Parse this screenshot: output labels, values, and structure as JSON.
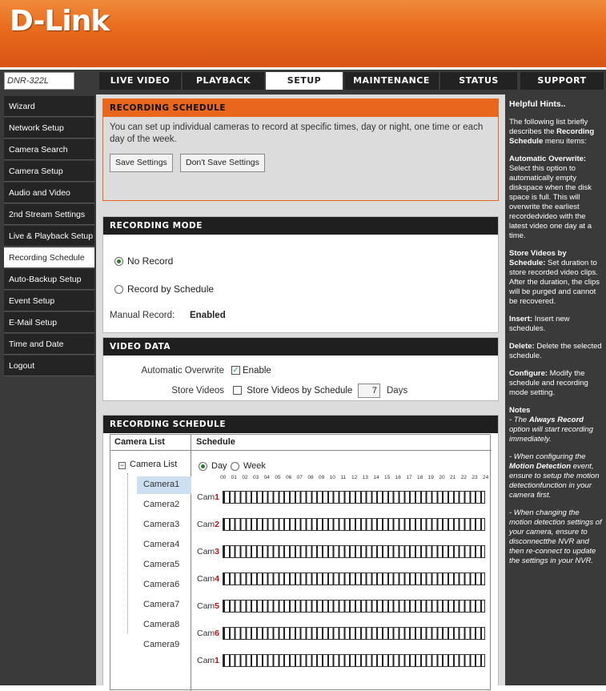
{
  "brand": {
    "logo": "D-Link",
    "model": "DNR-322L"
  },
  "tabs": [
    {
      "label": "LIVE VIDEO"
    },
    {
      "label": "PLAYBACK"
    },
    {
      "label": "SETUP"
    },
    {
      "label": "MAINTENANCE"
    },
    {
      "label": "STATUS"
    },
    {
      "label": "SUPPORT"
    }
  ],
  "sidebar": {
    "items": [
      {
        "label": "Wizard"
      },
      {
        "label": "Network Setup"
      },
      {
        "label": "Camera Search"
      },
      {
        "label": "Camera Setup"
      },
      {
        "label": "Audio and Video"
      },
      {
        "label": "2nd Stream Settings"
      },
      {
        "label": "Live & Playback Setup"
      },
      {
        "label": "Recording Schedule"
      },
      {
        "label": "Auto-Backup Setup"
      },
      {
        "label": "Event Setup"
      },
      {
        "label": "E-Mail Setup"
      },
      {
        "label": "Time and Date"
      },
      {
        "label": "Logout"
      }
    ]
  },
  "intro": {
    "title": "RECORDING SCHEDULE",
    "text": "You can set up individual cameras to record at specific times, day or night, one time or each day of the week.",
    "save_label": "Save Settings",
    "dont_save_label": "Don't Save Settings"
  },
  "recording_mode": {
    "title": "RECORDING MODE",
    "no_record_label": "No Record",
    "by_schedule_label": "Record by Schedule",
    "manual_label": "Manual Record:",
    "manual_value": "Enabled"
  },
  "video_data": {
    "title": "VIDEO DATA",
    "overwrite_label": "Automatic Overwrite",
    "overwrite_option": "Enable",
    "store_label": "Store Videos",
    "store_option": "Store Videos by Schedule",
    "days_value": "7",
    "days_unit": "Days"
  },
  "schedule": {
    "title": "RECORDING SCHEDULE",
    "col_camera_list": "Camera List",
    "col_schedule": "Schedule",
    "tree_root": "Camera List",
    "cameras": [
      "Camera1",
      "Camera2",
      "Camera3",
      "Camera4",
      "Camera5",
      "Camera6",
      "Camera7",
      "Camera8",
      "Camera9"
    ],
    "day_label": "Day",
    "week_label": "Week",
    "hours": [
      "00",
      "01",
      "02",
      "03",
      "04",
      "05",
      "06",
      "07",
      "08",
      "09",
      "10",
      "11",
      "12",
      "13",
      "14",
      "15",
      "16",
      "17",
      "18",
      "19",
      "20",
      "21",
      "22",
      "23",
      "24"
    ],
    "cam_prefix": "Cam",
    "cam_numbers": [
      "1",
      "2",
      "3",
      "4",
      "5",
      "6",
      "1"
    ]
  },
  "hints": {
    "title": "Helpful Hints..",
    "intro_pre": "The following list briefly describes the",
    "intro_bold": "Recording Schedule",
    "intro_post": "menu items:",
    "overwrite_title": "Automatic Overwrite:",
    "overwrite_text": "Select this option to automatically empty diskspace when the disk space is full. This will overwrite the earliest recordedvideo with the latest video one day at a time.",
    "store_title": "Store Videos by Schedule:",
    "store_text": "Set duration to store recorded video clips. After the duration, the clips will be purged and cannot be recovered.",
    "insert_title": "Insert:",
    "insert_text": "Insert new schedules.",
    "delete_title": "Delete:",
    "delete_text": "Delete the selected schedule.",
    "configure_title": "Configure:",
    "configure_text": "Modify the schedule and recording mode setting.",
    "notes_title": "Notes",
    "note1_pre": "- The",
    "note1_bold": "Always Record",
    "note1_post": "option will start recording immediately.",
    "note2_pre": "- When configuring the",
    "note2_bold": "Motion Detection",
    "note2_post": "event, ensure to setup the motion detectionfunction in your camera first.",
    "note3": "- When changing the motion detection settings of your camera, ensure to disconnectthe NVR and then re-connect to update the settings in your NVR."
  }
}
